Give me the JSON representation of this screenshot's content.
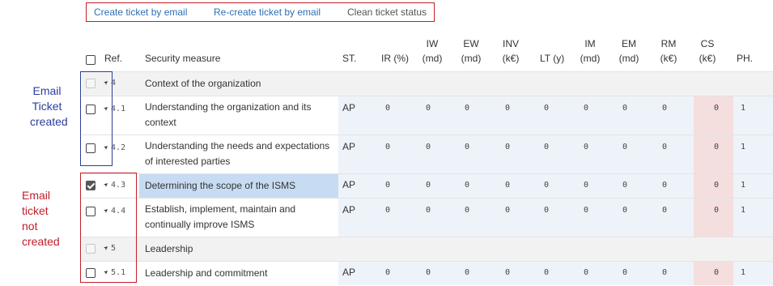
{
  "actions": {
    "create": "Create ticket by email",
    "recreate": "Re-create ticket by email",
    "clean": "Clean ticket status"
  },
  "annotations": {
    "created": [
      "Email",
      "Ticket",
      "created"
    ],
    "not_created": [
      "Email",
      "ticket",
      "not",
      "created"
    ]
  },
  "header": {
    "ref": "Ref.",
    "measure": "Security measure",
    "st": "ST.",
    "ir": "IR (%)",
    "iw": [
      "IW",
      "(md)"
    ],
    "ew": [
      "EW",
      "(md)"
    ],
    "inv": [
      "INV",
      "(k€)"
    ],
    "lt": "LT (y)",
    "im": [
      "IM",
      "(md)"
    ],
    "em": [
      "EM",
      "(md)"
    ],
    "rm": [
      "RM",
      "(k€)"
    ],
    "cs": [
      "CS",
      "(k€)"
    ],
    "ph": "PH."
  },
  "rows": [
    {
      "ref": "4",
      "measure": [
        "Context of the organization"
      ],
      "section": true
    },
    {
      "ref": "4.1",
      "measure": [
        "Understanding the organization and its",
        "context"
      ],
      "st": "AP",
      "vals": [
        "0",
        "0",
        "0",
        "0",
        "0",
        "0",
        "0",
        "0",
        "0",
        "1"
      ]
    },
    {
      "ref": "4.2",
      "measure": [
        "Understanding the needs and expectations",
        "of interested parties"
      ],
      "st": "AP",
      "vals": [
        "0",
        "0",
        "0",
        "0",
        "0",
        "0",
        "0",
        "0",
        "0",
        "1"
      ]
    },
    {
      "ref": "4.3",
      "measure": [
        "Determining the scope of the ISMS"
      ],
      "st": "AP",
      "vals": [
        "0",
        "0",
        "0",
        "0",
        "0",
        "0",
        "0",
        "0",
        "0",
        "1"
      ],
      "checked": true
    },
    {
      "ref": "4.4",
      "measure": [
        "Establish, implement, maintain and",
        "continually improve ISMS"
      ],
      "st": "AP",
      "vals": [
        "0",
        "0",
        "0",
        "0",
        "0",
        "0",
        "0",
        "0",
        "0",
        "1"
      ]
    },
    {
      "ref": "5",
      "measure": [
        "Leadership"
      ],
      "section": true
    },
    {
      "ref": "5.1",
      "measure": [
        "Leadership and commitment"
      ],
      "st": "AP",
      "vals": [
        "0",
        "0",
        "0",
        "0",
        "0",
        "0",
        "0",
        "0",
        "0",
        "1"
      ]
    }
  ],
  "icons": {
    "ref_arrow": "send-arrow-icon"
  }
}
